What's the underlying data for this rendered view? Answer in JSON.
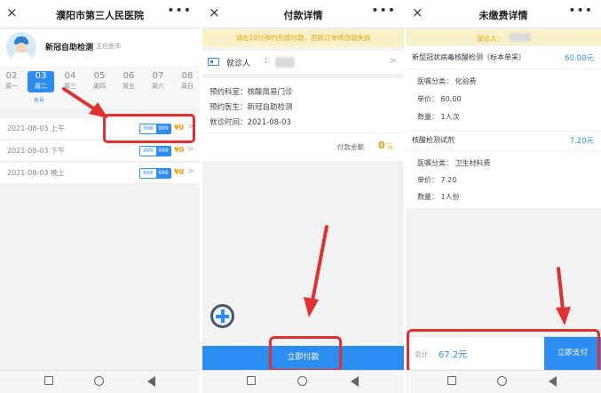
{
  "colors": {
    "accent": "#2d8cf0",
    "highlight": "#e03131",
    "price": "#f39800",
    "notice_bg": "#fbf1c9"
  },
  "screen1": {
    "title": "濮阳市第三人民医院",
    "close_icon": "×",
    "more_icon": "•••",
    "doctor": {
      "name": "新冠自助检测",
      "title": "主任医师"
    },
    "days": [
      {
        "date": "02",
        "weekday": "周一"
      },
      {
        "date": "03",
        "weekday": "周二",
        "selected": true
      },
      {
        "date": "04",
        "weekday": "周三"
      },
      {
        "date": "05",
        "weekday": "周四"
      },
      {
        "date": "06",
        "weekday": "周五"
      },
      {
        "date": "07",
        "weekday": "周六"
      },
      {
        "date": "08",
        "weekday": "周日"
      }
    ],
    "available": "有号",
    "slots": [
      {
        "label": "2021-08-03 上午",
        "total": "999",
        "remain": "999",
        "price": "¥0",
        "chev": ">"
      },
      {
        "label": "2021-08-03 下午",
        "total": "999",
        "remain": "999",
        "price": "¥0",
        "chev": ">"
      },
      {
        "label": "2021-08-03 晚上",
        "total": "666",
        "remain": "666",
        "price": "¥0",
        "chev": ">"
      }
    ]
  },
  "screen2": {
    "title": "付款详情",
    "close_icon": "×",
    "more_icon": "•••",
    "notice": "请在10分钟内完成付款，否则订单将自动失效",
    "patient_label": "就诊人",
    "patient_colon": ":",
    "chev": ">",
    "rows": [
      {
        "label": "预约科室",
        "value": "核酸简易门诊"
      },
      {
        "label": "预约医生",
        "value": "新冠自助检测"
      },
      {
        "label": "就诊时间",
        "value": "2021-08-03"
      }
    ],
    "colon": "：",
    "amount_label": "付款金额",
    "amount": "0",
    "amount_unit": "元",
    "pay_button": "立即付款"
  },
  "screen3": {
    "title": "未缴费详情",
    "close_icon": "×",
    "more_icon": "•••",
    "visitor_label": "就诊人：",
    "items": [
      {
        "name": "新型冠状病毒核酸检测（标本单采）",
        "price": "60.00元",
        "category": "医嘱分类：  化验费",
        "unit_price": "单价：  60.00",
        "qty": "数量：  1人次"
      },
      {
        "name": "核酸检测试剂",
        "price": "7.20元",
        "category": "医嘱分类：  卫生材料费",
        "unit_price": "单价：  7.20",
        "qty": "数量：  1人份"
      }
    ],
    "total_label": "总计:",
    "total": "67.2元",
    "pay_button": "立即支付"
  },
  "navbar": {
    "back_icon": "triangle-back-icon",
    "home_icon": "circle-home-icon",
    "recent_icon": "square-recent-icon"
  }
}
